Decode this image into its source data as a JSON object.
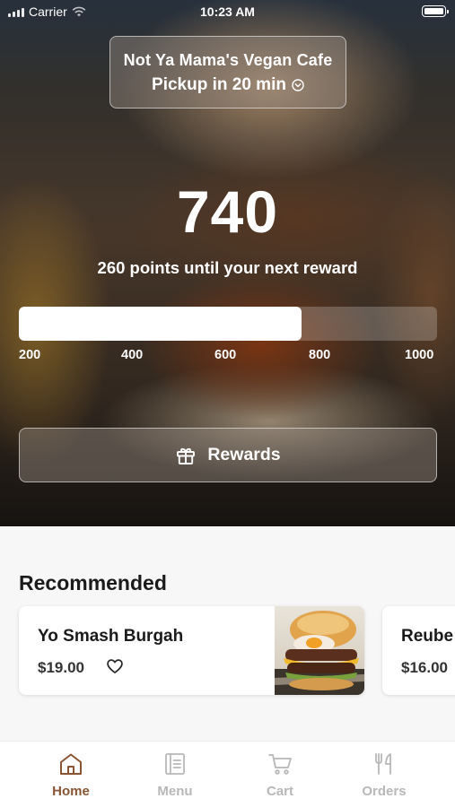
{
  "status_bar": {
    "carrier": "Carrier",
    "time": "10:23 AM"
  },
  "store": {
    "name": "Not Ya Mama's Vegan Cafe",
    "pickup": "Pickup in 20 min"
  },
  "rewards": {
    "points": "740",
    "subtitle": "260 points until your next reward",
    "progress_value": 740,
    "progress_range": [
      200,
      1000
    ],
    "ticks": [
      "200",
      "400",
      "600",
      "800",
      "1000"
    ],
    "button_label": "Rewards"
  },
  "recommended": {
    "title": "Recommended",
    "items": [
      {
        "name": "Yo Smash Burgah",
        "price": "$19.00"
      },
      {
        "name": "Reube",
        "price": "$16.00"
      }
    ]
  },
  "tabbar": {
    "active": "Home",
    "items": [
      {
        "label": "Home",
        "icon": "home-icon"
      },
      {
        "label": "Menu",
        "icon": "menu-book-icon"
      },
      {
        "label": "Cart",
        "icon": "cart-icon"
      },
      {
        "label": "Orders",
        "icon": "fork-knife-icon"
      }
    ]
  },
  "colors": {
    "accent": "#8b5533",
    "inactive_tab": "#b8b8b8",
    "progress_fill": "#ffffff"
  }
}
